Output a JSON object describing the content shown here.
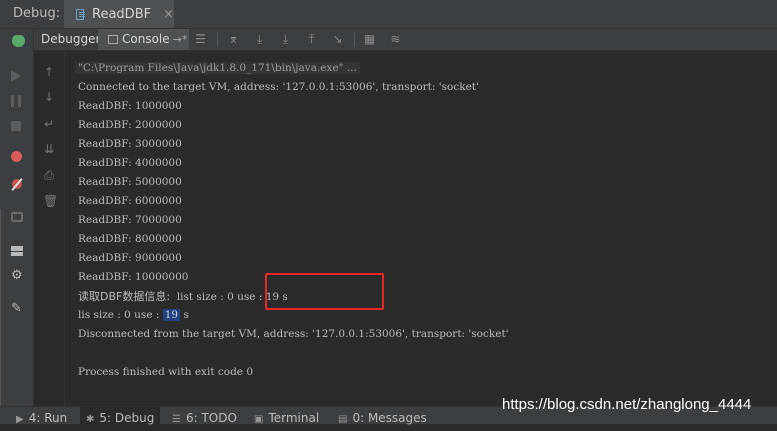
{
  "window": {
    "debug_label": "Debug:",
    "tab_title": "ReadDBF",
    "tab_close": "×"
  },
  "subtabs": {
    "debugger": "Debugger",
    "console": "Console",
    "console_arrow": "→*"
  },
  "console": {
    "command": "\"C:\\Program Files\\Java\\jdk1.8.0_171\\bin\\java.exe\" ...",
    "connected": "Connected to the target VM, address: '127.0.0.1:53006', transport: 'socket'",
    "reads": [
      "ReadDBF: 1000000",
      "ReadDBF: 2000000",
      "ReadDBF: 3000000",
      "ReadDBF: 4000000",
      "ReadDBF: 5000000",
      "ReadDBF: 6000000",
      "ReadDBF: 7000000",
      "ReadDBF: 8000000",
      "ReadDBF: 9000000",
      "ReadDBF: 10000000"
    ],
    "info_label": "读取DBF数据信息:",
    "info_rest": "  list size : 0 use : 19 s",
    "lis_prefix": "lis size : 0 use : ",
    "lis_highlight": "19",
    "lis_suffix": " s",
    "disconnected": "Disconnected from the target VM, address: '127.0.0.1:53006', transport: 'socket'",
    "finished": "Process finished with exit code 0"
  },
  "bottom_tabs": {
    "run": "4: Run",
    "debug": "5: Debug",
    "todo": "6: TODO",
    "terminal": "Terminal",
    "messages": "0: Messages"
  },
  "watermark": "https://blog.csdn.net/zhanglong_4444",
  "colors": {
    "background": "#2b2b2b",
    "toolbar": "#3c3f41",
    "highlight_box": "#e62828",
    "selection": "#214283"
  }
}
